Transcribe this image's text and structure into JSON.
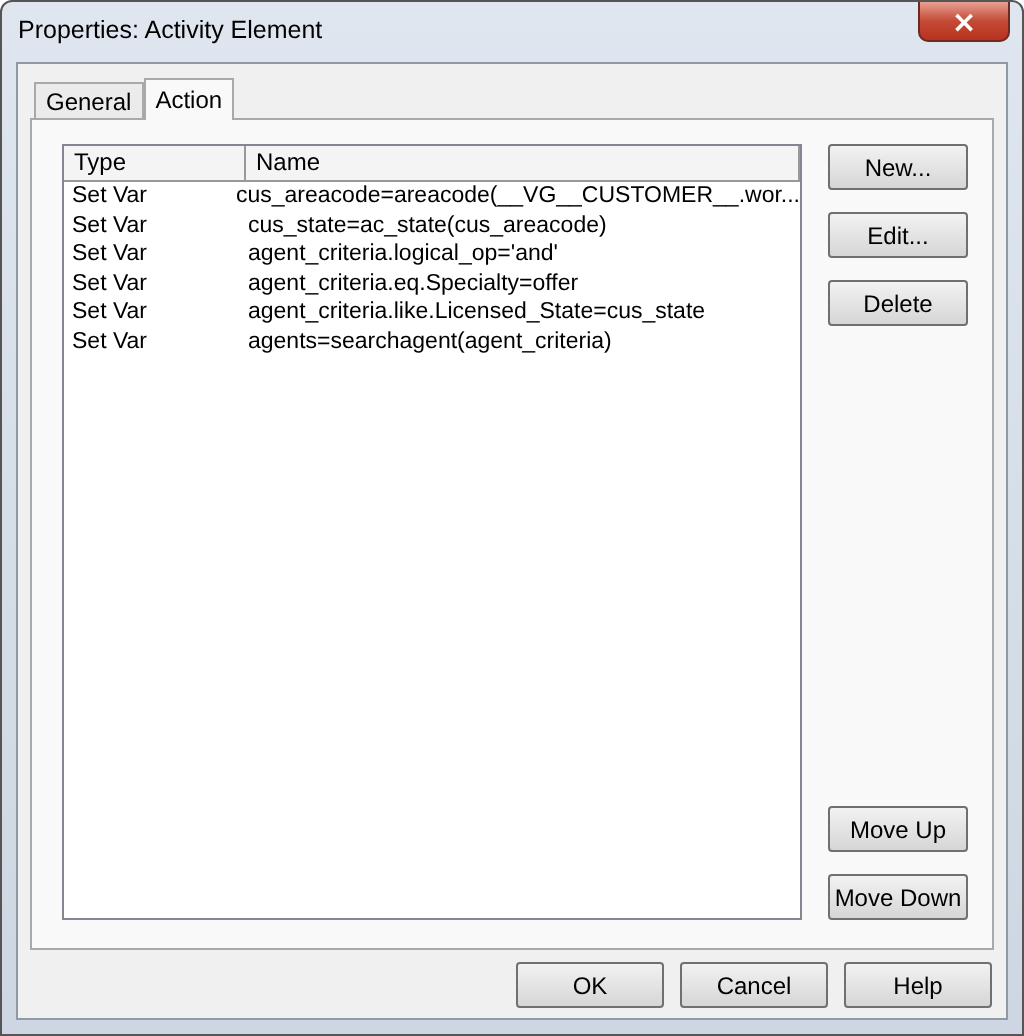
{
  "window": {
    "title": "Properties: Activity Element",
    "close": "×"
  },
  "tabs": [
    {
      "label": "General",
      "selected": false
    },
    {
      "label": "Action",
      "selected": true
    }
  ],
  "table": {
    "columns": [
      "Type",
      "Name"
    ],
    "rows": [
      [
        "Set Var",
        "cus_areacode=areacode(__VG__CUSTOMER__.wor..."
      ],
      [
        "Set Var",
        "cus_state=ac_state(cus_areacode)"
      ],
      [
        "Set Var",
        "agent_criteria.logical_op='and'"
      ],
      [
        "Set Var",
        "agent_criteria.eq.Specialty=offer"
      ],
      [
        "Set Var",
        "agent_criteria.like.Licensed_State=cus_state"
      ],
      [
        "Set Var",
        "agents=searchagent(agent_criteria)"
      ]
    ]
  },
  "side_buttons_top": [
    "New...",
    "Edit...",
    "Delete"
  ],
  "side_buttons_bottom": [
    "Move Up",
    "Move Down"
  ],
  "buttons": [
    "OK",
    "Cancel",
    "Help"
  ]
}
